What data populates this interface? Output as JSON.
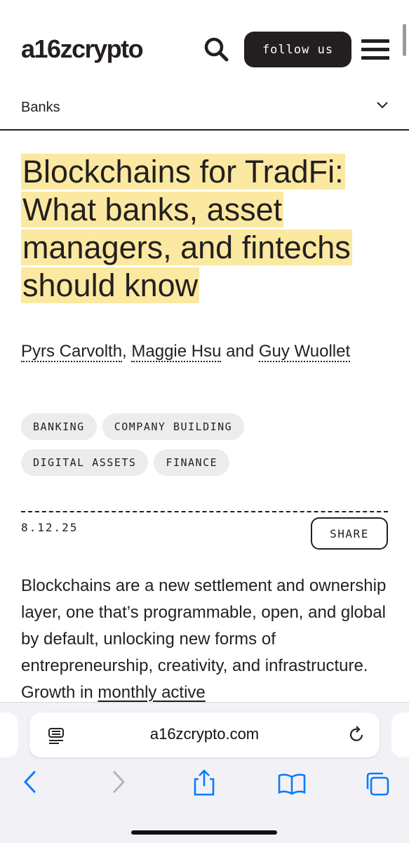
{
  "header": {
    "logo": "a16zcrypto",
    "follow_label": "follow us"
  },
  "subnav": {
    "label": "Banks"
  },
  "article": {
    "title": "Blockchains for TradFi: What banks, asset managers, and fintechs should know",
    "authors": {
      "author1": "Pyrs Carvolth",
      "sep1": ", ",
      "author2": "Maggie Hsu",
      "sep2": " and ",
      "author3": "Guy Wuollet"
    },
    "tags": [
      "BANKING",
      "COMPANY BUILDING",
      "DIGITAL ASSETS",
      "FINANCE"
    ],
    "date": "8.12.25",
    "share_label": "SHARE",
    "body_text": "Blockchains are a new settlement and ownership layer, one that’s programmable, open, and global by default, unlocking new forms of entrepreneurship, creativity, and infrastructure. Growth in ",
    "body_link": "monthly active"
  },
  "browser": {
    "url": "a16zcrypto.com",
    "icons": [
      "reader-icon",
      "reload-icon",
      "back-icon",
      "forward-icon",
      "share-icon",
      "bookmarks-icon",
      "tabs-icon"
    ]
  },
  "colors": {
    "ink": "#231f20",
    "highlight": "#fbe9a1",
    "tag_bg": "#ececec",
    "chrome_bg": "#f2f2f6",
    "ios_blue": "#0a7aff"
  }
}
